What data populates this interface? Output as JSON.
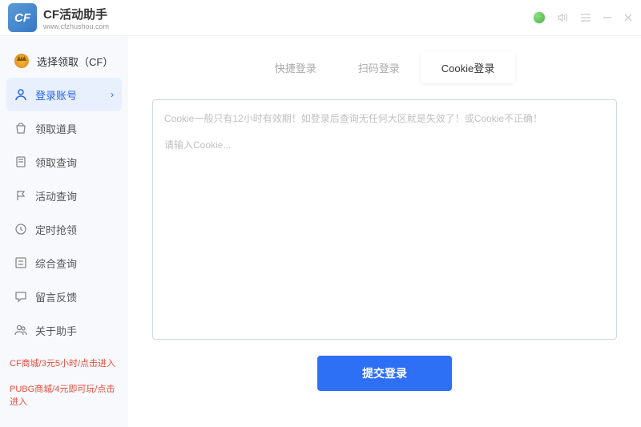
{
  "header": {
    "logo_text": "CF",
    "title": "CF活动助手",
    "subtitle": "www.cfzhushou.com"
  },
  "sidebar": {
    "items": [
      {
        "label": "选择领取（CF）"
      },
      {
        "label": "登录账号"
      },
      {
        "label": "领取道具"
      },
      {
        "label": "领取查询"
      },
      {
        "label": "活动查询"
      },
      {
        "label": "定时抢领"
      },
      {
        "label": "综合查询"
      },
      {
        "label": "留言反馈"
      },
      {
        "label": "关于助手"
      }
    ],
    "promos": [
      "CF商城/3元5小时/点击进入",
      "PUBG商城/4元即可玩/点击进入"
    ]
  },
  "tabs": [
    {
      "label": "快捷登录"
    },
    {
      "label": "扫码登录"
    },
    {
      "label": "Cookie登录"
    }
  ],
  "cookie": {
    "hint": "Cookie一般只有12小时有效期！如登录后查询无任何大区就是失效了！或Cookie不正确！",
    "placeholder": "请输入Cookie..."
  },
  "submit_label": "提交登录"
}
